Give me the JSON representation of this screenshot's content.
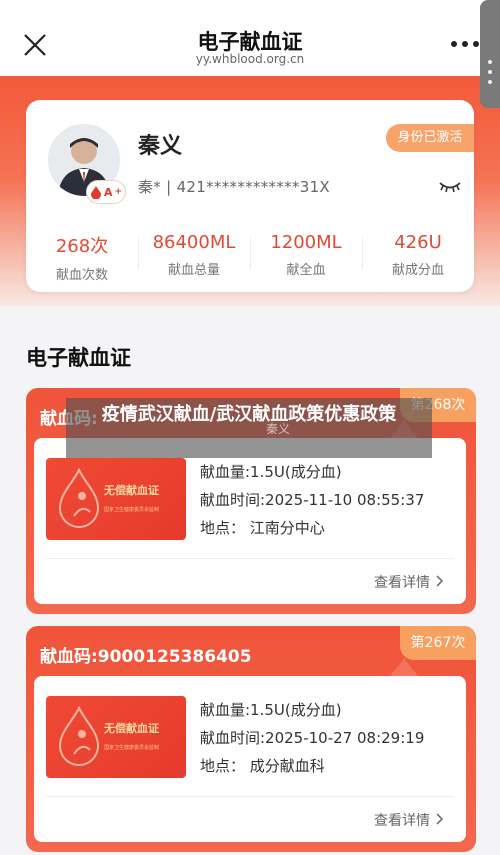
{
  "nav": {
    "title": "电子献血证",
    "url": "yy.whblood.org.cn"
  },
  "profile": {
    "name": "秦义",
    "blood_type": "A",
    "blood_rh": "+",
    "id_masked": "秦* | 421************31X",
    "verified_label": "身份已激活",
    "stats": [
      {
        "value": "268次",
        "label": "献血次数"
      },
      {
        "value": "86400ML",
        "label": "献血总量"
      },
      {
        "value": "1200ML",
        "label": "献全血"
      },
      {
        "value": "426U",
        "label": "献成分血"
      }
    ]
  },
  "section": {
    "title": "电子献血证"
  },
  "records": [
    {
      "code": "献血码:",
      "times": "第268次",
      "certificate_title": "无偿献血证",
      "certificate_sub": "国家卫生健康委员会监制",
      "amount": "献血量:1.5U(成分血)",
      "time": "献血时间:2025-11-10 08:55:37",
      "place": "地点：   江南分中心",
      "detail": "查看详情"
    },
    {
      "code": "献血码:9000125386405",
      "times": "第267次",
      "certificate_title": "无偿献血证",
      "certificate_sub": "国家卫生健康委员会监制",
      "amount": "献血量:1.5U(成分血)",
      "time": "献血时间:2025-10-27 08:29:19",
      "place": "地点：   成分献血科",
      "detail": "查看详情"
    }
  ],
  "overlay": {
    "title": "疫情武汉献血/武汉献血政策优惠政策",
    "watermark_text": "秦义"
  },
  "colors": {
    "brand": "#f0543a",
    "badge": "#f7a05f"
  }
}
